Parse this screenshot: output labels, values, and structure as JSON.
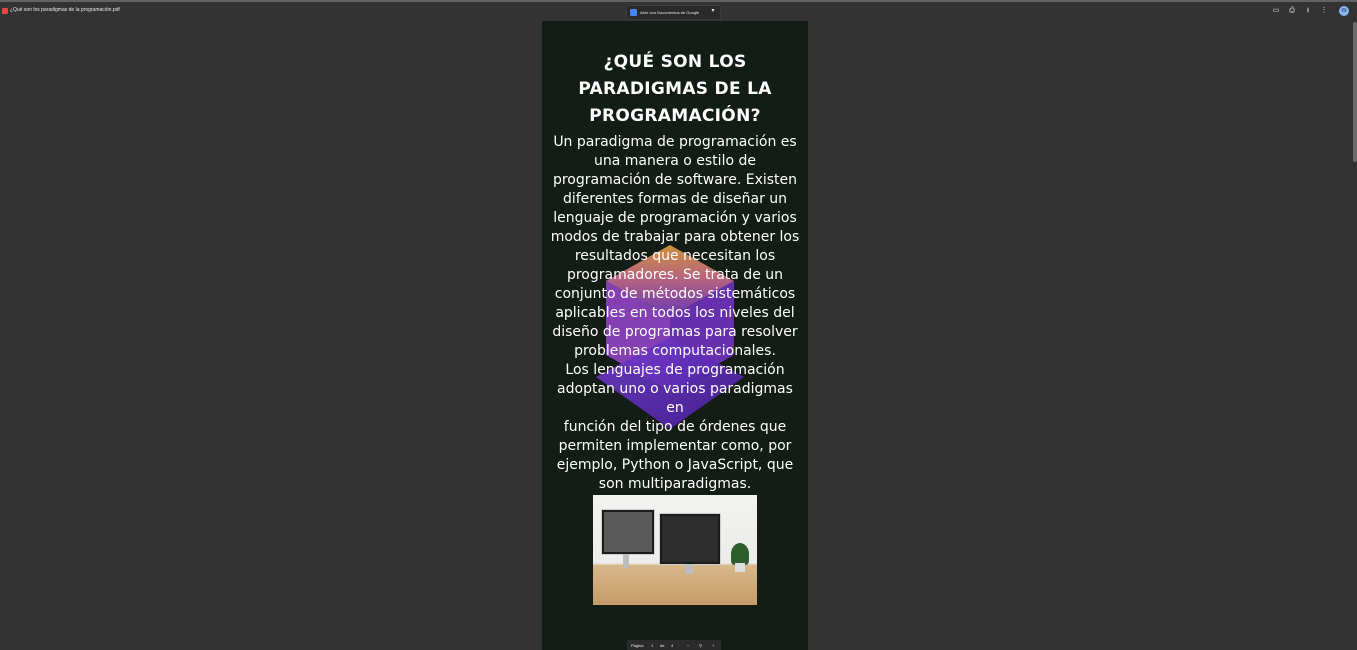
{
  "window": {
    "file_title": "¿Qué son los paradigmas de la programación.pdf",
    "open_with_label": "Abrir con Documentos de Google"
  },
  "icons": {
    "file": "pdf-file-icon",
    "google_docs": "google-docs-icon",
    "dropdown": "chevron-down-icon",
    "annotate": "annotate-icon",
    "print": "print-icon",
    "download": "download-icon",
    "more": "more-vert-icon",
    "avatar": "user-avatar"
  },
  "avatar_initial": "m",
  "document": {
    "title": "¿QUÉ SON LOS PARADIGMAS DE LA PROGRAMACIÓN?",
    "body_lines": [
      "Un paradigma de programación es",
      "una manera o estilo de",
      "programación de software. Existen",
      "diferentes formas de diseñar un",
      "lenguaje de programación y varios",
      "modos de trabajar para obtener los",
      "resultados que necesitan los",
      "programadores. Se trata de un",
      "conjunto de métodos sistemáticos",
      "aplicables en todos los niveles del",
      "diseño de programas para resolver",
      "problemas computacionales.",
      "Los lenguajes de programación",
      "adoptan uno o varios paradigmas en",
      "función del tipo de órdenes que",
      "permiten implementar como, por",
      "ejemplo, Python o JavaScript, que",
      "son multiparadigmas."
    ]
  },
  "pager": {
    "page_label": "Página",
    "current": "1",
    "of_label": "de",
    "total": "4",
    "zoom_out": "−",
    "zoom_in": "+"
  },
  "colors": {
    "background": "#333333",
    "page_background": "#141c16",
    "accent_purple": "#7b3fe4",
    "accent_orange": "#f5a442"
  }
}
